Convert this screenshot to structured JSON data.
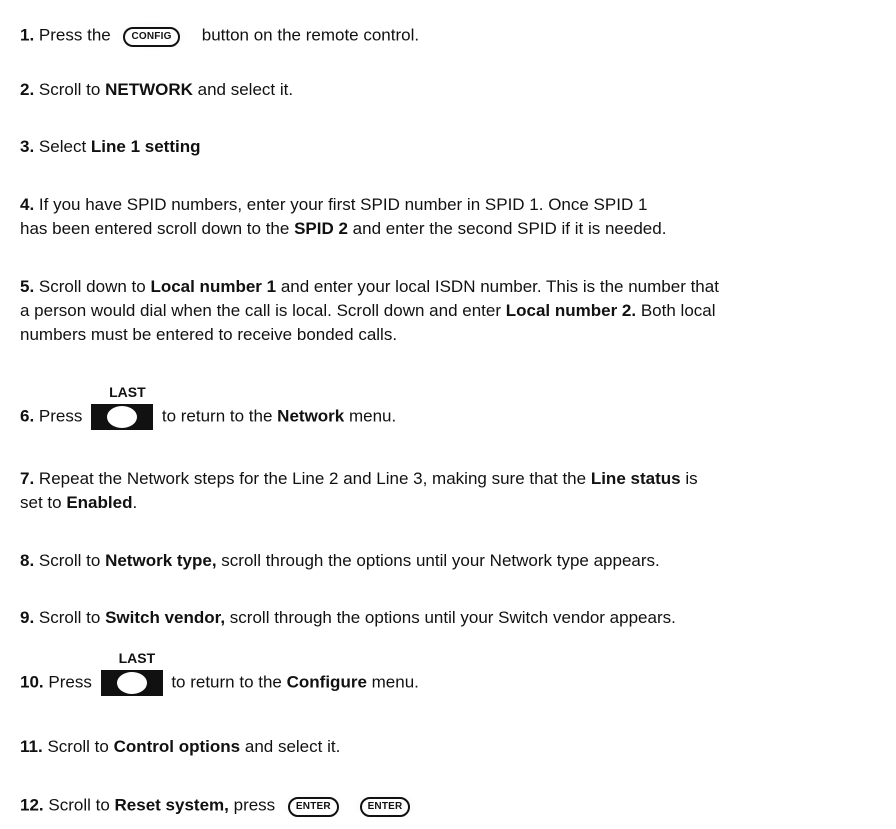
{
  "steps": [
    {
      "num": "1.",
      "pre": "Press the",
      "button": "CONFIG",
      "post": "button on the remote control."
    },
    {
      "num": "2.",
      "pre": "Scroll to",
      "bold": "NETWORK",
      "post": "and select it."
    },
    {
      "num": "3.",
      "pre": "Select",
      "bold": "Line 1 setting"
    },
    {
      "num": "4.",
      "line1": "If you have SPID numbers, enter your first SPID number in SPID 1. Once SPID 1",
      "line2_pre": "has been entered scroll down to the",
      "line2_bold": "SPID 2",
      "line2_post": "and enter the second SPID if it is needed."
    },
    {
      "num": "5.",
      "l1_pre": "Scroll down to",
      "l1_bold": "Local number 1",
      "l1_post": "and enter your local ISDN number. This is the number that",
      "l2_pre": "a person would dial when the call is local. Scroll down and enter",
      "l2_bold": "Local number 2.",
      "l2_post": "Both local",
      "l3": "numbers must be entered to receive bonded calls."
    },
    {
      "num": "6.",
      "pre": "Press",
      "button": "LAST",
      "post1": "to return to the",
      "bold": "Network",
      "post2": "menu."
    },
    {
      "num": "7.",
      "l1_pre": "Repeat the Network steps for the Line 2 and Line 3, making sure that the",
      "l1_bold": "Line status",
      "l1_post": "is",
      "l2_pre": "set to",
      "l2_bold": "Enabled",
      "l2_post": "."
    },
    {
      "num": "8.",
      "pre": "Scroll to",
      "bold": "Network type,",
      "post": "scroll through the options until your Network type appears."
    },
    {
      "num": "9.",
      "pre": "Scroll to",
      "bold": "Switch vendor,",
      "post": "scroll through the options until your Switch vendor appears."
    },
    {
      "num": "10.",
      "pre": "Press",
      "button": "LAST",
      "post1": "to return to the",
      "bold": "Configure",
      "post2": "menu."
    },
    {
      "num": "11.",
      "pre": "Scroll to",
      "bold": "Control options",
      "post": "and select it."
    },
    {
      "num": "12.",
      "pre": "Scroll to",
      "bold": "Reset system,",
      "post": "press",
      "button": "ENTER"
    }
  ]
}
